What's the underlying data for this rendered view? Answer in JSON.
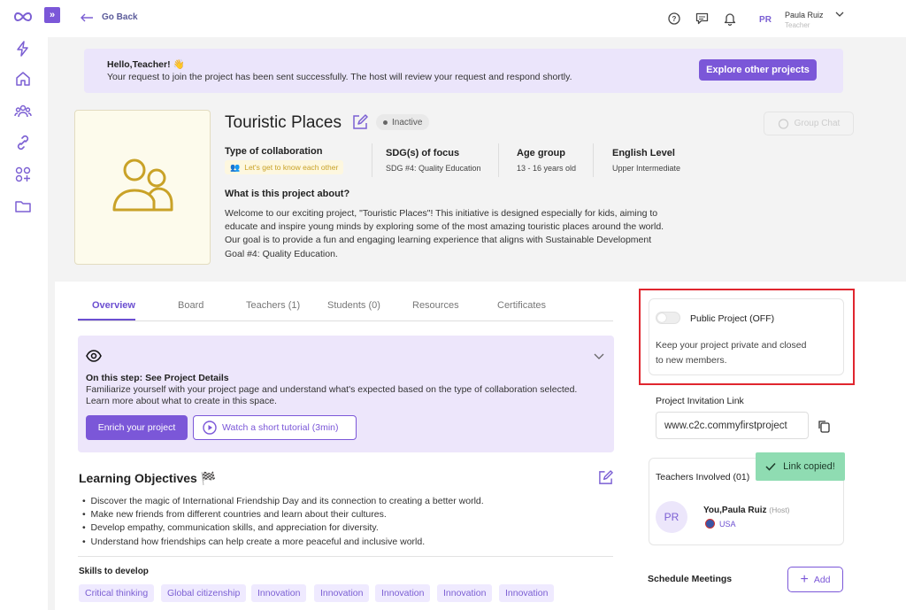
{
  "app": {
    "logo": "infinity-logo-icon"
  },
  "sidebar": {
    "items": [
      {
        "icon": "bolt-icon"
      },
      {
        "icon": "home-icon"
      },
      {
        "icon": "community-icon"
      },
      {
        "icon": "link-icon"
      },
      {
        "icon": "apps-add-icon"
      },
      {
        "icon": "folder-icon"
      }
    ]
  },
  "topbar": {
    "back_label": "Go Back",
    "user": {
      "initials": "PR",
      "name": "Paula Ruiz",
      "role": "Teacher"
    }
  },
  "banner": {
    "greeting": "Hello,Teacher! 👋",
    "message": "Your request to join the project has been sent successfully. The host will review your request and respond shortly.",
    "button": "Explore other projects"
  },
  "project": {
    "title": "Touristic Places",
    "status": "Inactive",
    "group_chat": "Group Chat",
    "collab_label": "Type of collaboration",
    "collab_value": "Let's get to know each other",
    "sdg_label": "SDG(s) of focus",
    "sdg_value": "SDG #4: Quality Education",
    "age_label": "Age group",
    "age_value": "13 - 16 years old",
    "english_label": "English Level",
    "english_value": "Upper Intermediate",
    "about_label": "What is this project about?",
    "about_lines": [
      "Welcome to our exciting project, \"Touristic Places\"! This initiative is designed especially for kids, aiming to",
      "educate and inspire young minds by exploring some of the most amazing touristic places around the world.",
      "Our goal is to provide a fun and engaging learning experience that aligns with Sustainable Development",
      "Goal #4: Quality Education."
    ]
  },
  "tabs": [
    "Overview",
    "Board",
    "Teachers (1)",
    "Students (0)",
    "Resources",
    "Certificates"
  ],
  "step": {
    "title": "On this step: See Project Details",
    "line1": "Familiarize yourself with your project page and understand what's expected based on the type of collaboration selected.",
    "line2": "Learn more about what to create in this space.",
    "enrich": "Enrich your project",
    "tutorial": "Watch a short tutorial (3min)"
  },
  "objectives": {
    "title": "Learning Objectives 🏁",
    "items": [
      "Discover the magic of International Friendship Day and its connection to creating a better world.",
      "Make new friends from different countries and learn about their cultures.",
      "Develop empathy, communication skills, and appreciation for diversity.",
      "Understand how friendships can help create a more peaceful and inclusive world."
    ]
  },
  "skills": {
    "title": "Skills to develop",
    "items": [
      "Critical thinking",
      "Global citizenship",
      "Innovation",
      "Innovation",
      "Innovation",
      "Innovation",
      "Innovation"
    ]
  },
  "public": {
    "label": "Public Project (OFF)",
    "enabled": false,
    "desc1": "Keep your project private and closed",
    "desc2": "to new members."
  },
  "invite": {
    "label": "Project Invitation Link",
    "value": "www.c2c.commyfirstproject"
  },
  "toast": "Link copied!",
  "teachers": {
    "title": "Teachers Involved (01)",
    "member": {
      "initials": "PR",
      "name": "You,Paula Ruiz",
      "tag": "(Host)",
      "country": "USA"
    }
  },
  "meetings": {
    "title": "Schedule Meetings",
    "add": "Add"
  },
  "colors": {
    "accent": "#7b57d8",
    "highlight": "#e0262f",
    "toast": "#8fdcb2",
    "gold": "#c9a227"
  }
}
